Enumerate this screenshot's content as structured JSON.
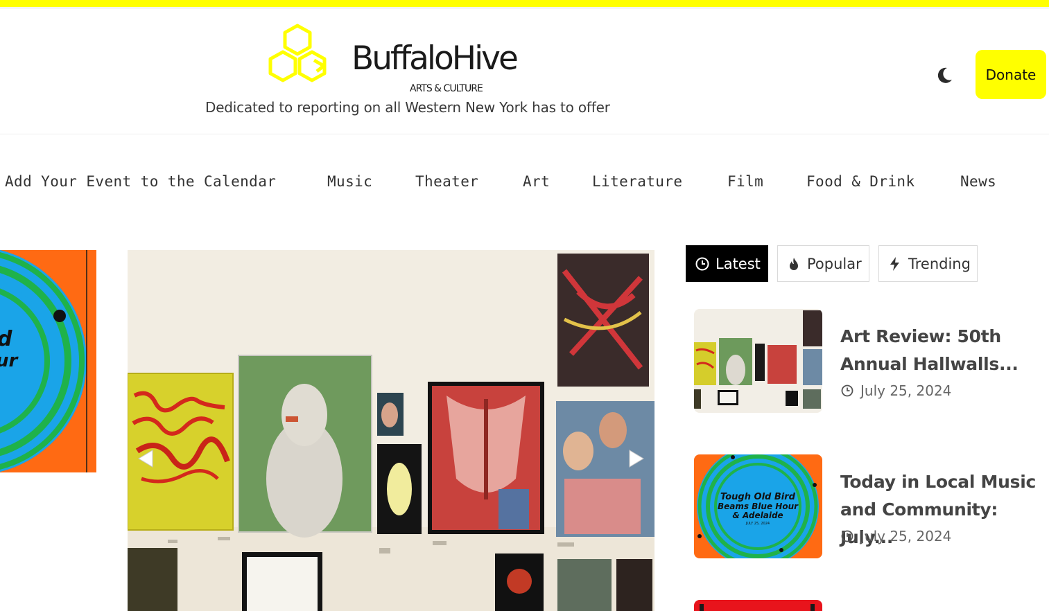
{
  "brand": {
    "name": "BuffaloHive",
    "subtitle": "ARTS & CULTURE",
    "tagline": "Dedicated to reporting on all Western New York has to offer",
    "accent_color": "#ffff00"
  },
  "header": {
    "theme_toggle_icon": "moon-icon",
    "donate_label": "Donate"
  },
  "nav": {
    "items": [
      {
        "label": "Add Your Event to the Calendar"
      },
      {
        "label": "Music"
      },
      {
        "label": "Theater"
      },
      {
        "label": "Art"
      },
      {
        "label": "Literature"
      },
      {
        "label": "Film"
      },
      {
        "label": "Food & Drink"
      },
      {
        "label": "News"
      }
    ]
  },
  "slider": {
    "prev_icon": "triangle-left-icon",
    "next_icon": "triangle-right-icon"
  },
  "sidebar": {
    "tabs": [
      {
        "label": "Latest",
        "icon": "clock-icon",
        "active": true
      },
      {
        "label": "Popular",
        "icon": "flame-icon",
        "active": false
      },
      {
        "label": "Trending",
        "icon": "bolt-icon",
        "active": false
      }
    ],
    "posts": [
      {
        "title": "Art Review: 50th Annual Hallwalls...",
        "date": "July 25, 2024"
      },
      {
        "title": "Today in Local Music and Community: July...",
        "date": "July 25, 2024",
        "thumb_text": [
          "Tough Old Bird",
          "Beams Blue Hour",
          "& Adelaide",
          "JULY 25, 2024"
        ]
      }
    ]
  }
}
